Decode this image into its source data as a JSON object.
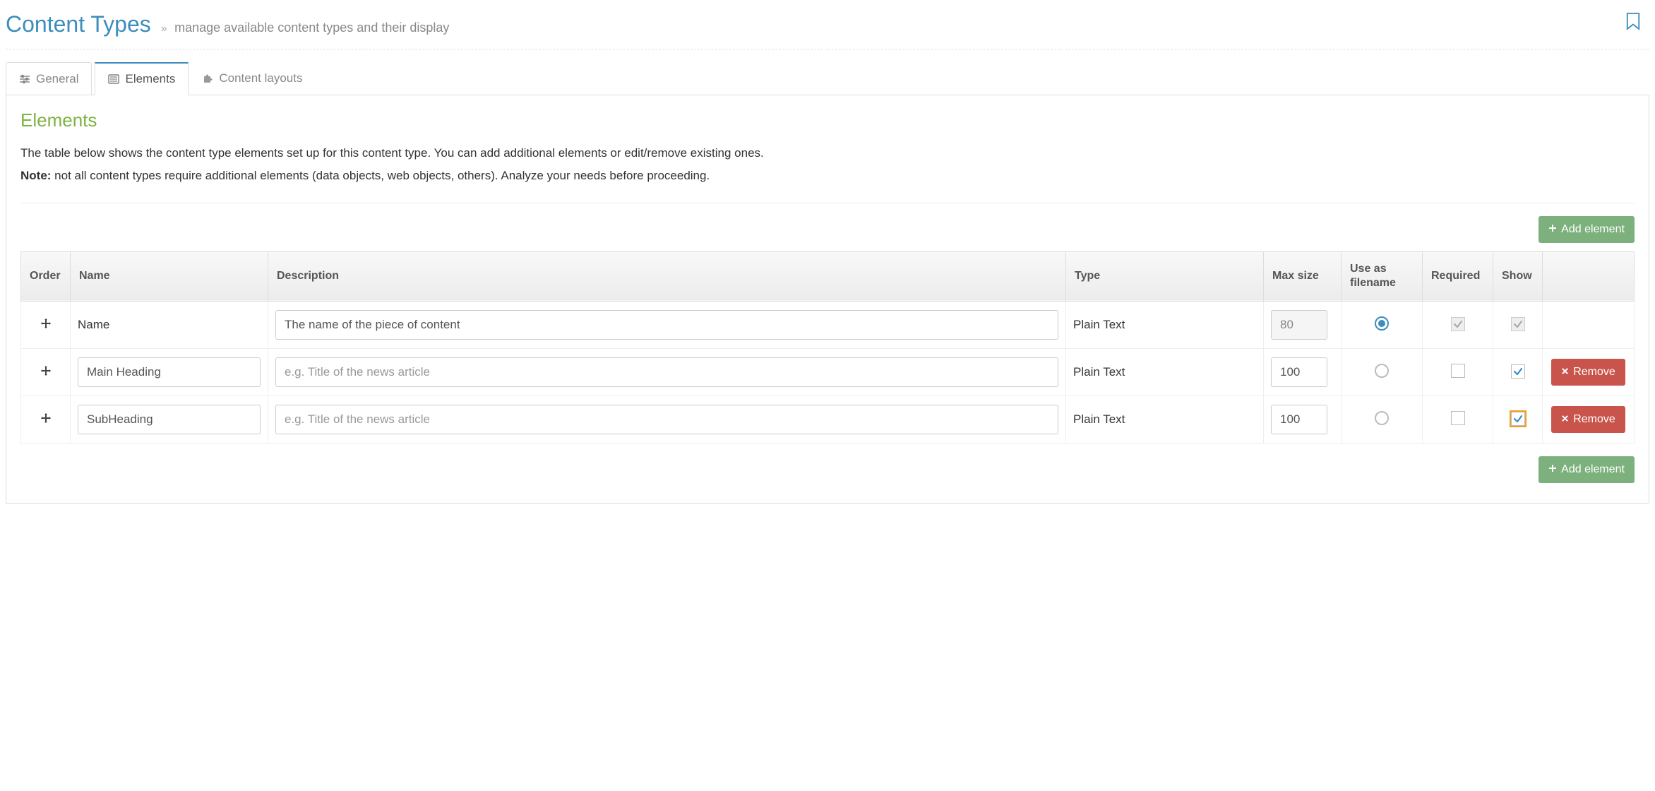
{
  "header": {
    "title": "Content Types",
    "subtitle": "manage available content types and their display"
  },
  "tabs": {
    "general": "General",
    "elements": "Elements",
    "layouts": "Content layouts"
  },
  "section": {
    "title": "Elements",
    "desc": "The table below shows the content type elements set up for this content type. You can add additional elements or edit/remove existing ones.",
    "note_label": "Note:",
    "note_text": " not all content types require additional elements (data objects, web objects, others). Analyze your needs before proceeding."
  },
  "buttons": {
    "add_element": "Add element",
    "remove": "Remove"
  },
  "table": {
    "headers": {
      "order": "Order",
      "name": "Name",
      "description": "Description",
      "type": "Type",
      "max_size": "Max size",
      "use_as_filename": "Use as filename",
      "required": "Required",
      "show": "Show"
    },
    "rows": [
      {
        "name_label": "Name",
        "name_value": "",
        "name_editable": false,
        "desc_value": "The name of the piece of content",
        "desc_placeholder": "",
        "type": "Plain Text",
        "max_size": "80",
        "max_editable": false,
        "filename_selected": true,
        "required_checked": true,
        "required_disabled": true,
        "show_checked": true,
        "show_disabled": true,
        "removable": false
      },
      {
        "name_label": "",
        "name_value": "Main Heading",
        "name_editable": true,
        "desc_value": "",
        "desc_placeholder": "e.g. Title of the news article",
        "type": "Plain Text",
        "max_size": "100",
        "max_editable": true,
        "filename_selected": false,
        "required_checked": false,
        "required_disabled": false,
        "show_checked": true,
        "show_disabled": false,
        "removable": true
      },
      {
        "name_label": "",
        "name_value": "SubHeading",
        "name_editable": true,
        "desc_value": "",
        "desc_placeholder": "e.g. Title of the news article",
        "type": "Plain Text",
        "max_size": "100",
        "max_editable": true,
        "filename_selected": false,
        "required_checked": false,
        "required_disabled": false,
        "show_checked": true,
        "show_disabled": false,
        "show_focused": true,
        "removable": true
      }
    ]
  }
}
